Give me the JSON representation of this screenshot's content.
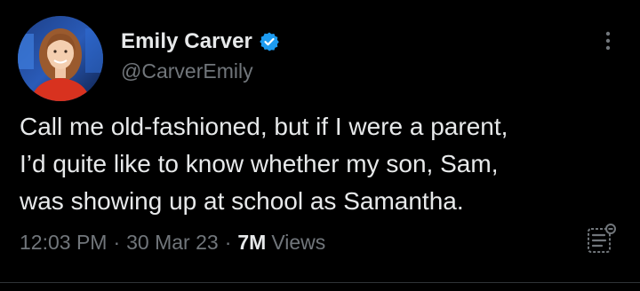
{
  "author": {
    "display_name": "Emily Carver",
    "handle": "@CarverEmily",
    "verified": true
  },
  "tweet": {
    "text": "Call me old-fashioned, but if I were a parent,\nI’d quite like to know whether my son, Sam,\nwas showing up at school as Samantha.",
    "time": "12:03 PM",
    "separator": "·",
    "date": "30 Mar 23",
    "views_count": "7M",
    "views_label": "Views"
  },
  "icons": {
    "verified": "verified-badge-icon",
    "more": "more-options-icon",
    "analytics": "post-analytics-icon"
  },
  "colors": {
    "background": "#000000",
    "text_primary": "#e7e9ea",
    "text_secondary": "#71767b",
    "verified_blue": "#1d9bf0",
    "divider": "#2f3336"
  }
}
